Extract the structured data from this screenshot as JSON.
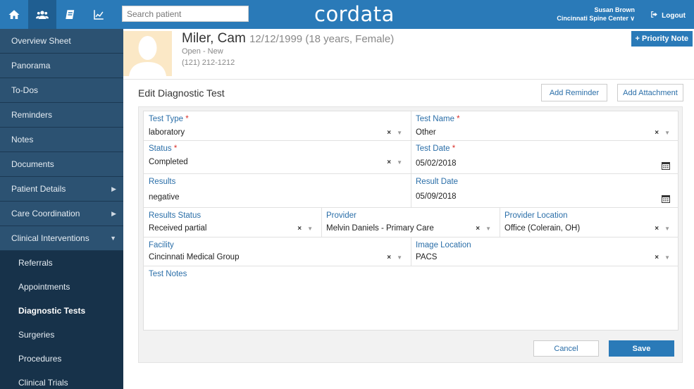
{
  "app": {
    "logo": "cordata",
    "search_placeholder": "Search patient",
    "user_name": "Susan Brown",
    "user_org": "Cincinnati Spine Center ∨",
    "logout_label": "Logout",
    "accent_color": "#2a7ab8",
    "sidebar_color": "#234563"
  },
  "nav_icons": [
    "home-icon",
    "users-icon",
    "book-icon",
    "chart-icon"
  ],
  "sidebar": {
    "items": [
      {
        "label": "Overview Sheet"
      },
      {
        "label": "Panorama"
      },
      {
        "label": "To-Dos"
      },
      {
        "label": "Reminders"
      },
      {
        "label": "Notes"
      },
      {
        "label": "Documents"
      },
      {
        "label": "Patient Details",
        "caret": "▶"
      },
      {
        "label": "Care Coordination",
        "caret": "▶"
      },
      {
        "label": "Clinical Interventions",
        "caret": "▼"
      }
    ],
    "sub_items": [
      {
        "label": "Referrals"
      },
      {
        "label": "Appointments"
      },
      {
        "label": "Diagnostic Tests"
      },
      {
        "label": "Surgeries"
      },
      {
        "label": "Procedures"
      },
      {
        "label": "Clinical Trials"
      }
    ]
  },
  "patient": {
    "name": "Miler, Cam",
    "dob": "12/12/1999 (18 years, Female)",
    "status": "Open - New",
    "phone": "(121) 212-1212",
    "priority_label": "Priority Note"
  },
  "page": {
    "title": "Edit Diagnostic Test",
    "add_reminder": "Add Reminder",
    "add_attachment": "Add Attachment",
    "cancel": "Cancel",
    "save": "Save"
  },
  "form": {
    "test_type": {
      "label": "Test Type",
      "value": "laboratory"
    },
    "test_name": {
      "label": "Test Name",
      "value": "Other"
    },
    "status": {
      "label": "Status",
      "value": "Completed"
    },
    "test_date": {
      "label": "Test Date",
      "value": "05/02/2018"
    },
    "results": {
      "label": "Results",
      "value": "negative"
    },
    "result_date": {
      "label": "Result Date",
      "value": "05/09/2018"
    },
    "results_status": {
      "label": "Results Status",
      "value": "Received partial"
    },
    "provider": {
      "label": "Provider",
      "value": "Melvin Daniels - Primary Care"
    },
    "provider_location": {
      "label": "Provider Location",
      "value": "Office (Colerain, OH)"
    },
    "facility": {
      "label": "Facility",
      "value": "Cincinnati Medical Group"
    },
    "image_location": {
      "label": "Image Location",
      "value": "PACS"
    },
    "test_notes": {
      "label": "Test Notes",
      "value": ""
    },
    "required_mark": "*",
    "clear_glyph": "×",
    "dropdown_glyph": "▼"
  }
}
